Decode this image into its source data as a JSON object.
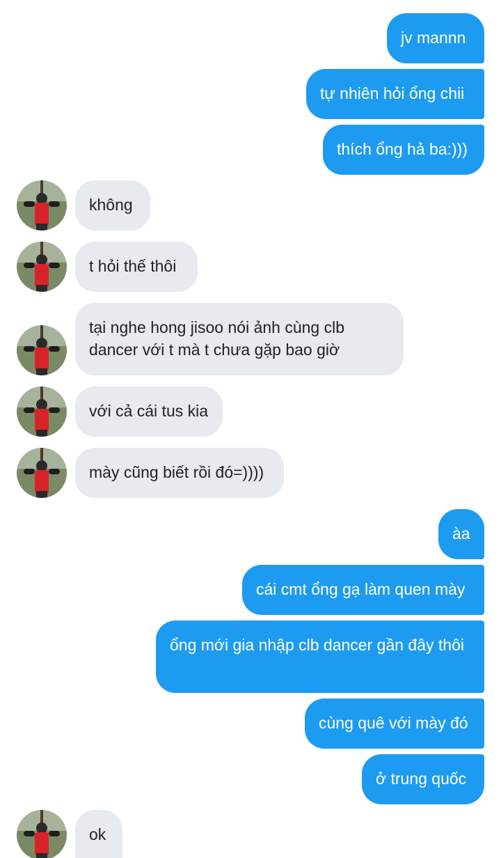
{
  "chat": {
    "messages": [
      {
        "id": "m1",
        "side": "out",
        "text": "jv mannn"
      },
      {
        "id": "m2",
        "side": "out",
        "text": "tự nhiên hỏi ổng chii"
      },
      {
        "id": "m3",
        "side": "out",
        "text": "thích ổng hả ba:)))"
      },
      {
        "id": "m4",
        "side": "in",
        "text": "không"
      },
      {
        "id": "m5",
        "side": "in",
        "text": "t hỏi thế thôi"
      },
      {
        "id": "m6",
        "side": "in",
        "text": "tại nghe hong jisoo nói ảnh cùng clb dancer với t mà t chưa gặp bao giờ"
      },
      {
        "id": "m7",
        "side": "in",
        "text": "với cả cái tus kia"
      },
      {
        "id": "m8",
        "side": "in",
        "text": "mày cũng biết rồi đó=))))"
      },
      {
        "id": "m9",
        "side": "out",
        "text": "àa"
      },
      {
        "id": "m10",
        "side": "out",
        "text": "cái cmt ổng gạ làm quen mày"
      },
      {
        "id": "m11",
        "side": "out",
        "text": "ổng mới gia nhập clb dancer gần đây thôi"
      },
      {
        "id": "m12",
        "side": "out",
        "text": "cùng quê với mày đó"
      },
      {
        "id": "m13",
        "side": "out",
        "text": "ở trung quốc"
      },
      {
        "id": "m14",
        "side": "in",
        "text": "ok"
      }
    ]
  },
  "colors": {
    "outgoing_bubble": "#1d9bf0",
    "incoming_bubble": "#e7eaee",
    "outgoing_text": "#ffffff",
    "incoming_text": "#222222",
    "background": "#ffffff"
  },
  "icons": {
    "avatar": "contact-avatar-photo"
  }
}
